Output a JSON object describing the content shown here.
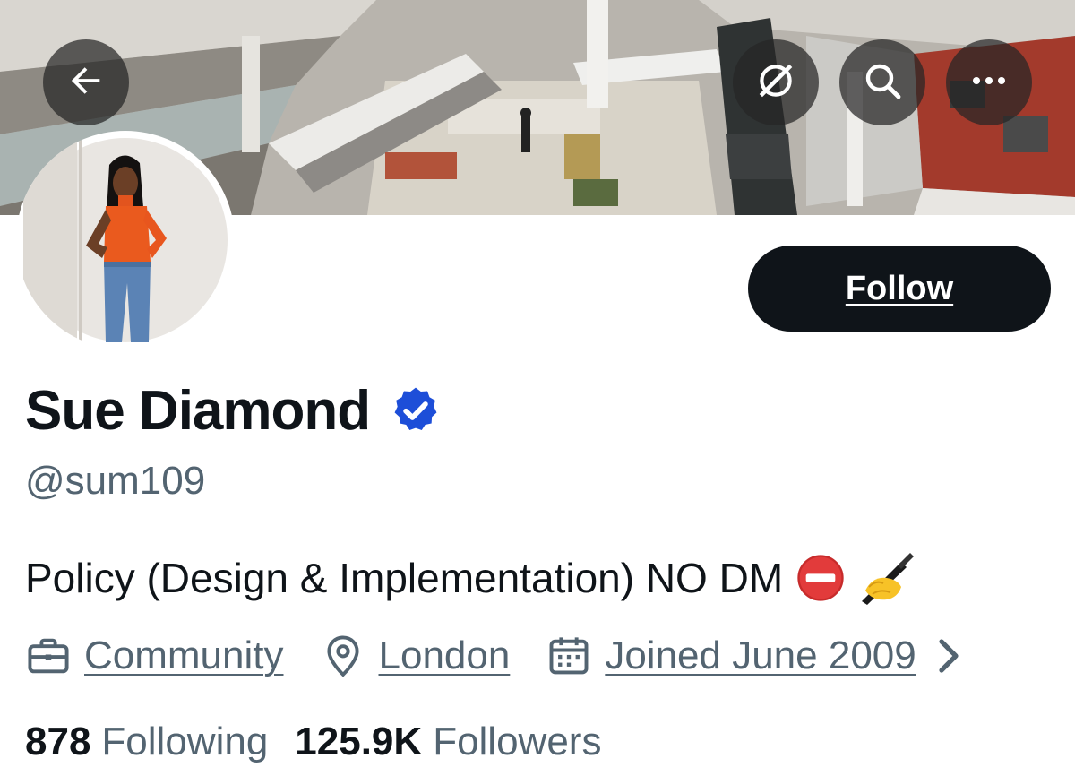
{
  "header": {
    "back_icon": "arrow-left-icon",
    "grok_icon": "grok-slash-icon",
    "search_icon": "search-icon",
    "more_icon": "more-horizontal-icon",
    "banner_description_colors": {
      "floor": "#c8c1b4",
      "red_carpet": "#a33a2c"
    }
  },
  "profile": {
    "display_name": "Sue Diamond",
    "handle": "@sum109",
    "bio_text": "Policy (Design & Implementation) NO DM",
    "bio_emojis": [
      "no-entry-icon",
      "writing-hand-icon"
    ],
    "follow_label": "Follow",
    "verified": true,
    "accent_color": "#1d4ed8"
  },
  "meta": {
    "category": "Community",
    "location": "London",
    "joined": "Joined June 2009"
  },
  "stats": {
    "following_count": "878",
    "following_label": "Following",
    "followers_count": "125.9K",
    "followers_label": "Followers"
  }
}
